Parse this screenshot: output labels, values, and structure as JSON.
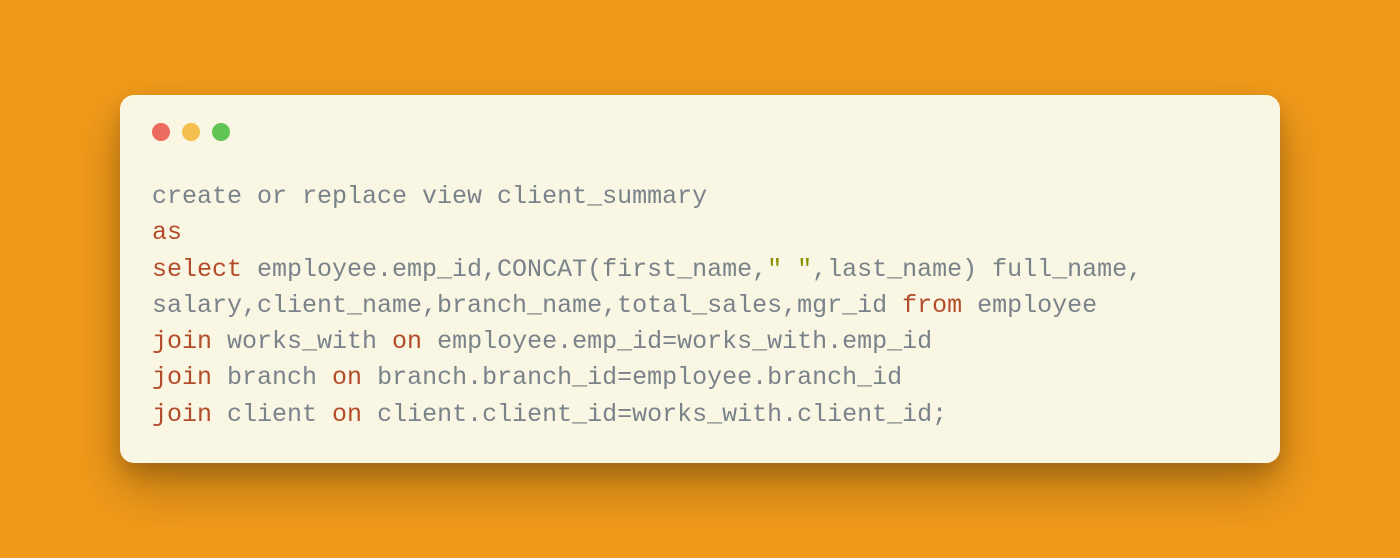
{
  "window_controls": {
    "red": "close",
    "yellow": "minimize",
    "green": "maximize"
  },
  "code": {
    "l1_a": "create or replace view client_summary",
    "l2_a": "as",
    "l3_a": "select",
    "l3_b": " employee.emp_id,CONCAT(first_name,",
    "l3_c": "\" \"",
    "l3_d": ",last_name) full_name,",
    "l4_a": "salary,client_name,branch_name,total_sales,mgr_id ",
    "l4_b": "from",
    "l4_c": " employee",
    "l5_a": "join",
    "l5_b": " works_with ",
    "l5_c": "on",
    "l5_d": " employee.emp_id=works_with.emp_id",
    "l6_a": "join",
    "l6_b": " branch ",
    "l6_c": "on",
    "l6_d": " branch.branch_id=employee.branch_id",
    "l7_a": "join",
    "l7_b": " client ",
    "l7_c": "on",
    "l7_d": " client.client_id=works_with.client_id;"
  }
}
